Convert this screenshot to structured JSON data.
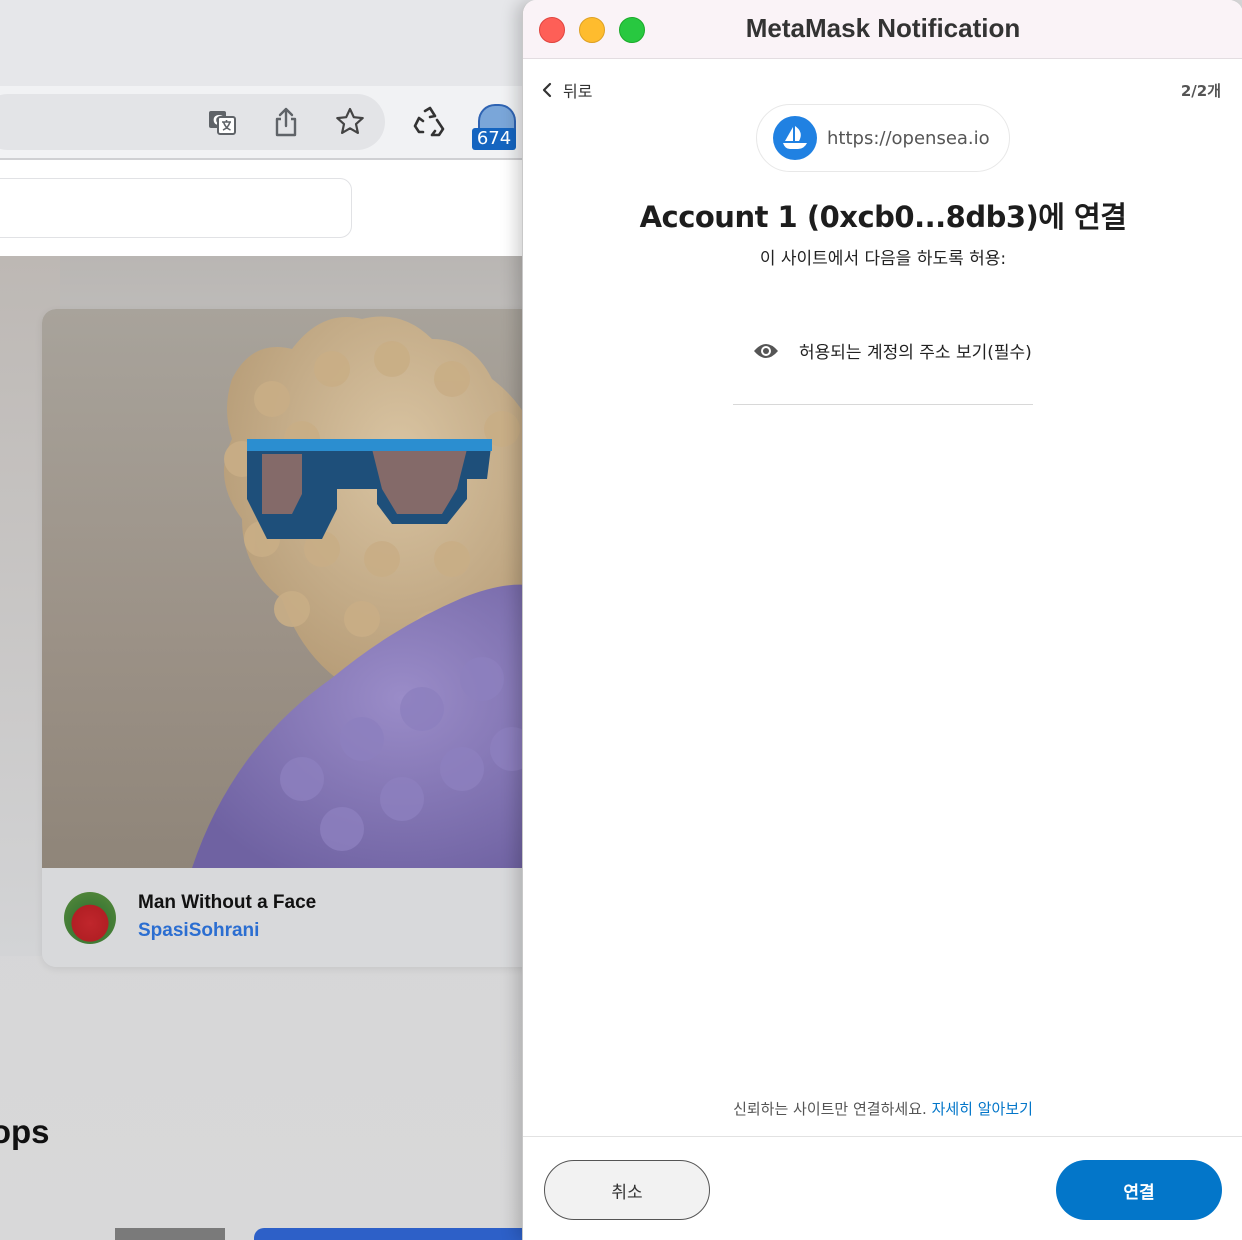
{
  "browser": {
    "extension_badge": "674",
    "nft": {
      "title": "Man Without a Face",
      "creator": "SpasiSohrani"
    },
    "drops_heading_fragment": "rops"
  },
  "metamask": {
    "window_title": "MetaMask Notification",
    "back_label": "뒤로",
    "page_count": "2/2개",
    "origin_url": "https://opensea.io",
    "heading": "Account 1 (0xcb0...8db3)에 연결",
    "subheading": "이 사이트에서 다음을 하도록 허용:",
    "permission": "허용되는 계정의 주소 보기(필수)",
    "trust_note": "신뢰하는 사이트만 연결하세요.",
    "learn_more": "자세히 알아보기",
    "cancel_label": "취소",
    "connect_label": "연결",
    "colors": {
      "primary": "#0376c9",
      "opensea_blue": "#2081e2"
    }
  }
}
